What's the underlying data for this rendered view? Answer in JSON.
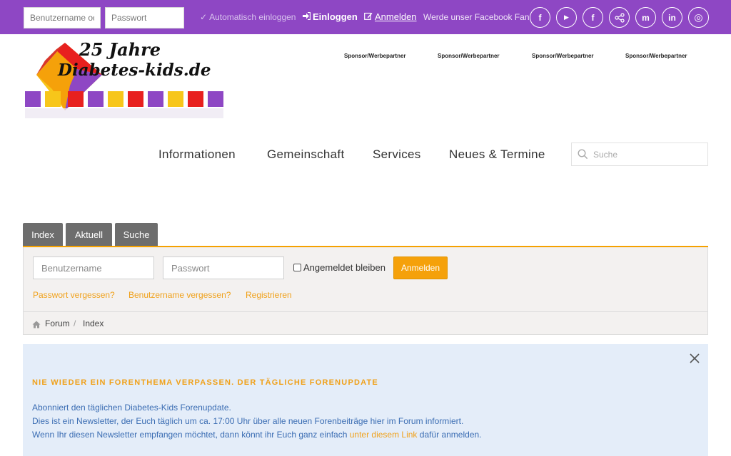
{
  "topbar": {
    "username_placeholder": "Benutzername oder",
    "password_placeholder": "Passwort",
    "remember_label": "Automatisch einloggen",
    "login_label": "Einloggen",
    "register_label": "Anmelden",
    "facebook_fan_label": "Werde unser Facebook Fan",
    "social": [
      {
        "icon": "facebook-icon",
        "glyph": "f"
      },
      {
        "icon": "youtube-icon",
        "glyph": "▶"
      },
      {
        "icon": "facebook-icon",
        "glyph": "f"
      },
      {
        "icon": "share-icon",
        "glyph": "⋖"
      },
      {
        "icon": "mastodon-icon",
        "glyph": "m"
      },
      {
        "icon": "linkedin-icon",
        "glyph": "in"
      },
      {
        "icon": "instagram-icon",
        "glyph": "◎"
      }
    ],
    "color": "#8e47c4"
  },
  "logo": {
    "line1": "25 Jahre",
    "line2": "Diabetes-kids.de"
  },
  "sponsors": [
    "Sponsor/Werbepartner",
    "Sponsor/Werbepartner",
    "Sponsor/Werbepartner",
    "Sponsor/Werbepartner"
  ],
  "nav": {
    "items": [
      "Informationen",
      "Gemeinschaft",
      "Services",
      "Neues & Termine"
    ],
    "search_placeholder": "Suche"
  },
  "tabs": [
    "Index",
    "Aktuell",
    "Suche"
  ],
  "login": {
    "username_placeholder": "Benutzername",
    "password_placeholder": "Passwort",
    "remember_label": "Angemeldet bleiben",
    "submit_label": "Anmelden",
    "links": [
      "Passwort vergessen?",
      "Benutzername vergessen?",
      "Registrieren"
    ],
    "accent": "#f5a10a"
  },
  "breadcrumb": {
    "forum": "Forum",
    "separator": "/",
    "index": "Index"
  },
  "info": {
    "title": "NIE WIEDER EIN FORENTHEMA VERPASSEN. DER TÄGLICHE FORENUPDATE",
    "line1": "Abonniert den täglichen Diabetes-Kids Forenupdate.",
    "line2": "Dies ist ein Newsletter, der Euch täglich um ca. 17:00 Uhr über alle neuen Forenbeiträge hier im Forum informiert.",
    "line3_pre": "Wenn Ihr diesen Newsletter empfangen möchtet, dann könnt ihr Euch ganz einfach ",
    "line3_link": "unter diesem Link",
    "line3_post": " dafür anmelden."
  }
}
